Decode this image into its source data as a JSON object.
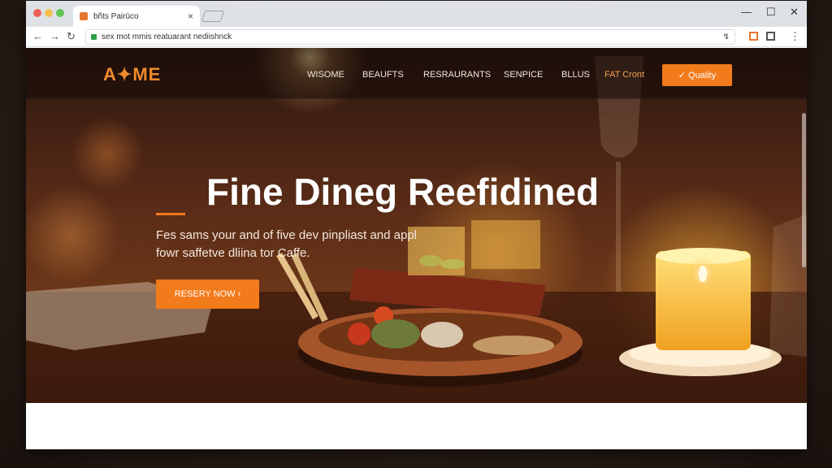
{
  "browser": {
    "tab_title": "bñts Pairūco",
    "tab_close": "×",
    "url": "sex mot mmis reatuarant nediishnck",
    "win_min": "—",
    "win_max": "☐",
    "win_close": "✕",
    "back": "←",
    "forward": "→",
    "reload": "↻",
    "omni_icon": "↯",
    "menu": "⋮"
  },
  "site": {
    "logo": "A✦ME",
    "nav": [
      "WISOME",
      "BEAUFTS",
      "RESRAURANTS",
      "SENPICE",
      "BLLUS",
      "FAT Cront"
    ],
    "cta": "✓ Quality",
    "hero_title": "Fine Dineg Reefidined",
    "hero_sub": "Fes sams your and of five dev pinpliast and appl fowr saffetve dliina tor Caffe.",
    "hero_button": "RESERY NOW ›"
  },
  "colors": {
    "accent": "#f27b1c",
    "logo": "#f08a2c",
    "secure": "#2e9e49"
  },
  "icons": [
    "back-icon",
    "forward-icon",
    "reload-icon",
    "lock-icon",
    "close-icon",
    "kebab-menu-icon"
  ]
}
